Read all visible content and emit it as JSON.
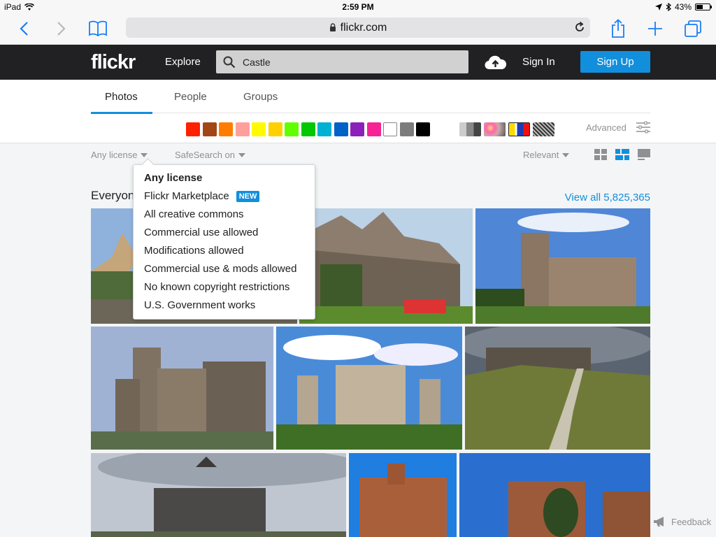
{
  "status_bar": {
    "device": "iPad",
    "time": "2:59 PM",
    "battery": "43%",
    "battery_level": 0.43
  },
  "safari": {
    "url": "flickr.com"
  },
  "header": {
    "logo": "flickr",
    "explore": "Explore",
    "search_value": "Castle",
    "sign_in": "Sign In",
    "sign_up": "Sign Up"
  },
  "tabs": [
    {
      "label": "Photos",
      "active": true
    },
    {
      "label": "People",
      "active": false
    },
    {
      "label": "Groups",
      "active": false
    }
  ],
  "colors": [
    "#ff2000",
    "#a24615",
    "#ff7c00",
    "#ff9f9c",
    "#fffa00",
    "#ffcf00",
    "#5fff00",
    "#01c801",
    "#01b0d2",
    "#0062c6",
    "#8c20ba",
    "#f52394",
    "#ffffff",
    "#7c7c7c",
    "#000000"
  ],
  "advanced_label": "Advanced",
  "filters": {
    "license": "Any license",
    "safesearch": "SafeSearch on",
    "sort": "Relevant"
  },
  "section_title": "Everyone's photos",
  "view_all": "View all 5,825,365",
  "license_menu": {
    "items": [
      {
        "label": "Any license",
        "selected": true
      },
      {
        "label": "Flickr Marketplace",
        "badge": "NEW"
      },
      {
        "label": "All creative commons"
      },
      {
        "label": "Commercial use allowed"
      },
      {
        "label": "Modifications allowed"
      },
      {
        "label": "Commercial use & mods allowed"
      },
      {
        "label": "No known copyright restrictions"
      },
      {
        "label": "U.S. Government works"
      }
    ]
  },
  "feedback": "Feedback",
  "accent": "#128fdc"
}
